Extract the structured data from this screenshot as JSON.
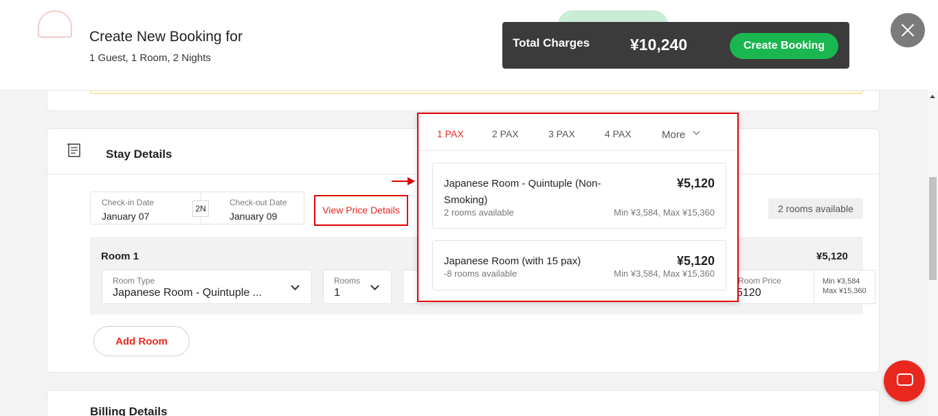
{
  "modal": {
    "title": "Create New Booking for",
    "subtitle": "1 Guest, 1 Room, 2 Nights",
    "total_label": "Total Charges",
    "total_amount": "¥10,240",
    "create_button": "Create Booking"
  },
  "stay": {
    "title": "Stay Details",
    "checkin_label": "Check-in Date",
    "checkin_value": "January 07",
    "nights": "2N",
    "checkout_label": "Check-out Date",
    "checkout_value": "January 09",
    "view_price": "View Price Details",
    "rooms_available": "2 rooms available",
    "room": {
      "label": "Room 1",
      "price": "¥5,120",
      "room_type_label": "Room Type",
      "room_type_value": "Japanese Room - Quintuple ...",
      "rooms_label": "Rooms",
      "rooms_value": "1",
      "room_price_label": "Room Price",
      "room_price_value": "5120",
      "min": "Min ¥3,584",
      "max": "Max ¥15,360"
    },
    "add_room": "Add Room"
  },
  "billing": {
    "title": "Billing Details"
  },
  "popup": {
    "tabs": [
      "1 PAX",
      "2 PAX",
      "3 PAX",
      "4 PAX"
    ],
    "more": "More",
    "options": [
      {
        "name": "Japanese Room - Quintuple (Non-Smoking)",
        "price": "¥5,120",
        "availability": "2 rooms available",
        "range": "Min ¥3,584, Max ¥15,360"
      },
      {
        "name": "Japanese Room (with 15 pax)",
        "price": "¥5,120",
        "availability": "-8 rooms available",
        "range": "Min ¥3,584, Max ¥15,360"
      }
    ]
  },
  "colors": {
    "accent": "#e8281f",
    "success": "#1ab64f",
    "dark_bar": "#3b3b3b"
  }
}
